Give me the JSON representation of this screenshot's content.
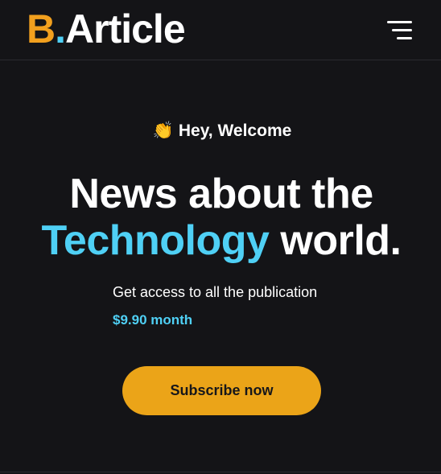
{
  "header": {
    "logo": {
      "letter": "B",
      "dot": ".",
      "word": "Article"
    },
    "menu_icon": "hamburger-menu-icon"
  },
  "hero": {
    "greeting_icon": "👏",
    "greeting": "Hey, Welcome",
    "headline_line1": "News about the",
    "headline_accent": "Technology",
    "headline_rest": " world.",
    "subtext": "Get access to all the publication",
    "price": "$9.90 month",
    "subscribe_label": "Subscribe now"
  },
  "colors": {
    "background": "#141417",
    "brand_orange": "#eba418",
    "accent_cyan": "#4fd0f5",
    "text": "#ffffff"
  }
}
